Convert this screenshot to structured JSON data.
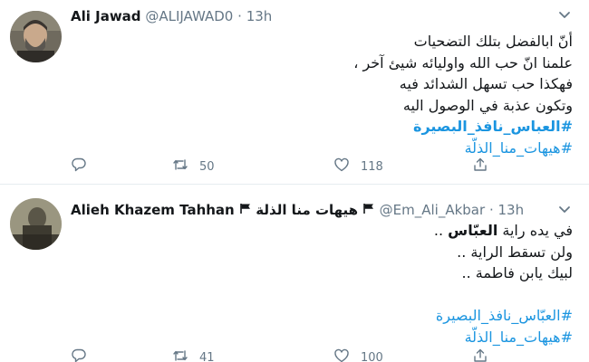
{
  "tweets": [
    {
      "display_name": "Ali Jawad",
      "handle": "@ALIJAWAD0",
      "separator": "·",
      "time": "13h",
      "lines": [
        "أنّ ابالفضل بتلك التضحيات",
        "علمنا انّ حب الله واوليائه شيئ آخر ،",
        "فهكذا حب تسهل الشدائد فيه",
        "وتكون عذبة في الوصول اليه"
      ],
      "hashtags": [
        "#العباس_نافذ_البصيرة",
        "#هيهات_منا_الذلّة"
      ],
      "replies": "",
      "retweets": "50",
      "likes": "118"
    },
    {
      "display_name": "Alieh Khazem Tahhan",
      "name_suffix": "هيهات منا الذلة",
      "handle": "@Em_Ali_Akbar",
      "separator": "·",
      "time": "13h",
      "line1_prefix": "في يده راية ",
      "line1_bold": "العبّاس",
      "line1_suffix": " ..",
      "lines": [
        "ولن تسقط الراية ..",
        "لبيك يابن فاطمة .."
      ],
      "hashtags": [
        "#العبّاس_نافذ_البصيرة",
        "#هيهات_منا_الذلّة"
      ],
      "replies": "",
      "retweets": "41",
      "likes": "100"
    }
  ],
  "colors": {
    "link": "#1b95e0",
    "muted": "#657786",
    "text": "#14171a",
    "divider": "#e6ecf0"
  },
  "icons": [
    "reply-icon",
    "retweet-icon",
    "like-icon",
    "share-icon",
    "caret-down-icon",
    "flag-icon"
  ]
}
